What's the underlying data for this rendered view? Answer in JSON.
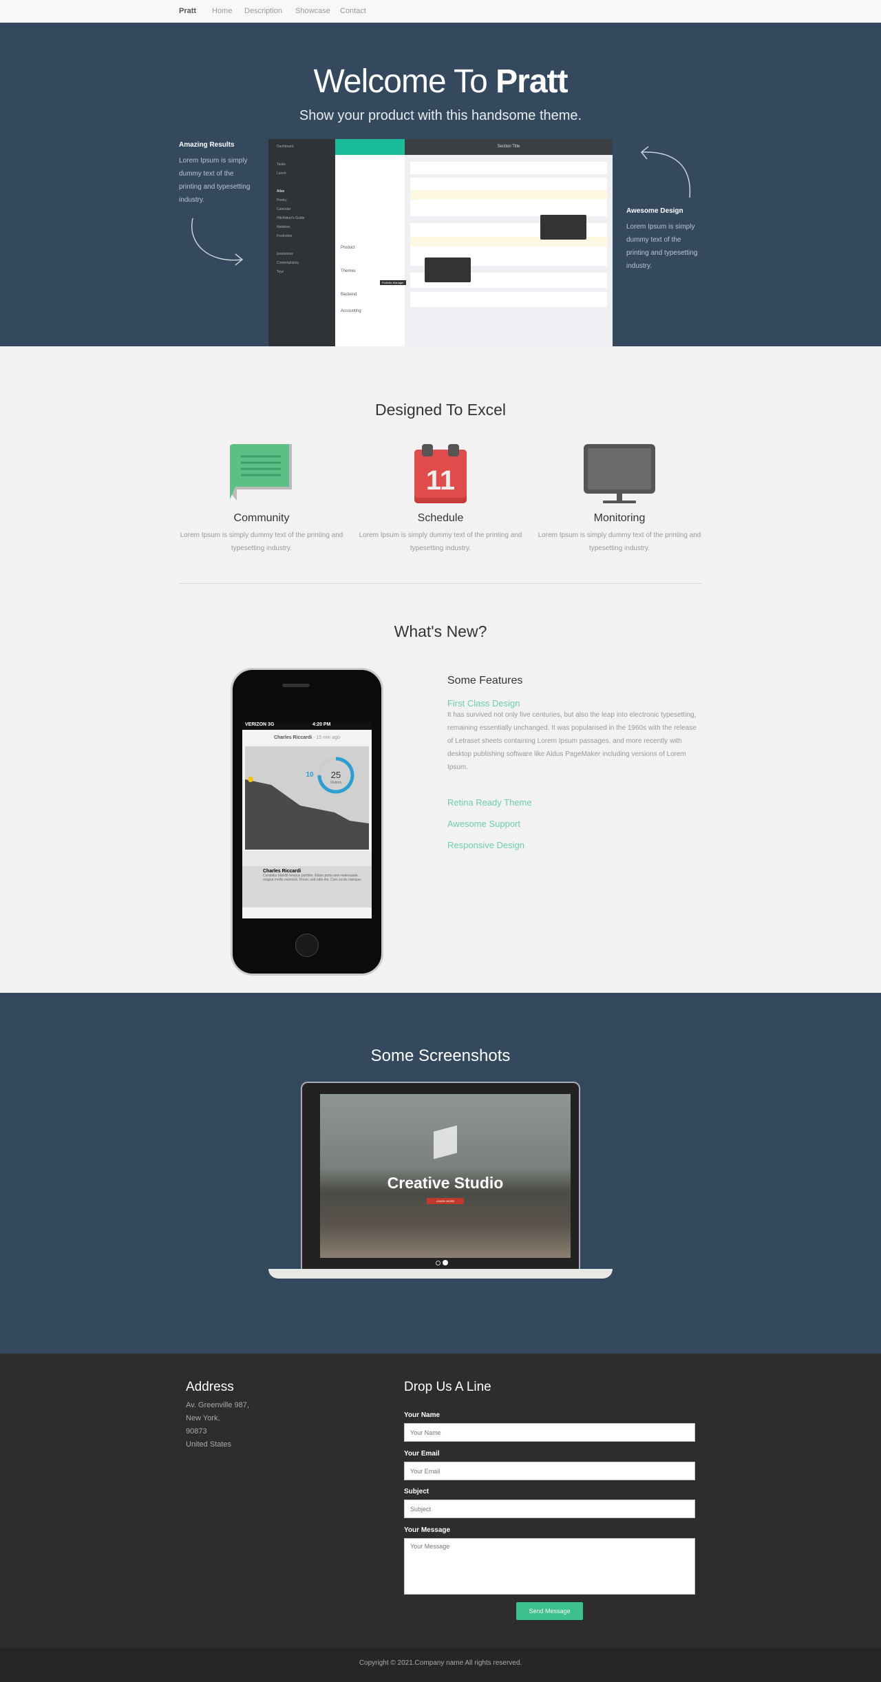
{
  "nav": {
    "brand": "Pratt",
    "items": [
      "Home",
      "Description",
      "Showcase",
      "Contact"
    ]
  },
  "hero": {
    "title_light": "Welcome To ",
    "title_bold": "Pratt",
    "subtitle": "Show your product with this handsome theme.",
    "left": {
      "heading": "Amazing Results",
      "text": "Lorem Ipsum is simply dummy text of the printing and typesetting industry."
    },
    "right": {
      "heading": "Awesome Design",
      "text": "Lorem Ipsum is simply dummy text of the printing and typesetting industry."
    },
    "mockup": {
      "sidebar_items": [
        "Dashboard",
        "Tasks",
        "Lunch",
        "Atlas",
        "Poetry",
        "Calendar",
        "Hitchhiker's Guide",
        "Notables",
        "Footnotes",
        "Ipsolutions",
        "Contemplatory",
        "Toys"
      ],
      "section_title": "Section Title",
      "list_groups": [
        "Product",
        "Themes",
        "Backend",
        "Accounting"
      ],
      "tooltip": "Portfolio Manager"
    }
  },
  "excel": {
    "title": "Designed To Excel",
    "items": [
      {
        "title": "Community",
        "text": "Lorem Ipsum is simply dummy text of the printing and typesetting industry.",
        "icon": "chat-bubble-icon",
        "color": "#5bbf86"
      },
      {
        "title": "Schedule",
        "text": "Lorem Ipsum is simply dummy text of the printing and typesetting industry.",
        "icon": "calendar-icon",
        "color": "#e04b4b",
        "day": "11"
      },
      {
        "title": "Monitoring",
        "text": "Lorem Ipsum is simply dummy text of the printing and typesetting industry.",
        "icon": "monitor-icon",
        "color": "#555555"
      }
    ]
  },
  "whats_new": {
    "title": "What's New?",
    "features_title": "Some Features",
    "features": [
      {
        "title": "First Class Design",
        "text": "It has survived not only five centuries, but also the leap into electronic typesetting, remaining essentially unchanged. It was popularised in the 1960s with the release of Letraset sheets containing Lorem Ipsum passages, and more recently with desktop publishing software like Aldus PageMaker including versions of Lorem Ipsum."
      },
      {
        "title": "Retina Ready Theme"
      },
      {
        "title": "Awesome Support"
      },
      {
        "title": "Responsive Design"
      }
    ],
    "phone": {
      "carrier": "VERIZON 3G",
      "time": "4:20 PM",
      "user": "Charles Riccardi",
      "ago": "· 15 min ago",
      "visitors": "25",
      "visitors_label": "Visitors",
      "likes": "10",
      "comment_name": "Charles Riccardi",
      "comment": "Curabitur blandit tempus porttitor. Etiam porta sem malesuada magna mollis euismod. Donec sed odio dui. Cum sociis natoque."
    }
  },
  "screenshots": {
    "title": "Some Screenshots",
    "screen_title": "Creative Studio",
    "screen_button": "LEARN MORE"
  },
  "footer": {
    "address_title": "Address",
    "address_lines": [
      "Av. Greenville 987,",
      "New York,",
      "90873",
      "United States"
    ],
    "form_title": "Drop Us A Line",
    "fields": [
      {
        "label": "Your Name",
        "placeholder": "Your Name"
      },
      {
        "label": "Your Email",
        "placeholder": "Your Email"
      },
      {
        "label": "Subject",
        "placeholder": "Subject"
      },
      {
        "label": "Your Message",
        "placeholder": "Your Message"
      }
    ],
    "submit": "Send Message",
    "copyright": "Copyright © 2021.Company name All rights reserved.",
    "accent": "#3cc08f"
  },
  "colors": {
    "hero_bg": "#34495e",
    "footer_bg": "#2d2d2d",
    "accent": "#6ccfa7"
  }
}
